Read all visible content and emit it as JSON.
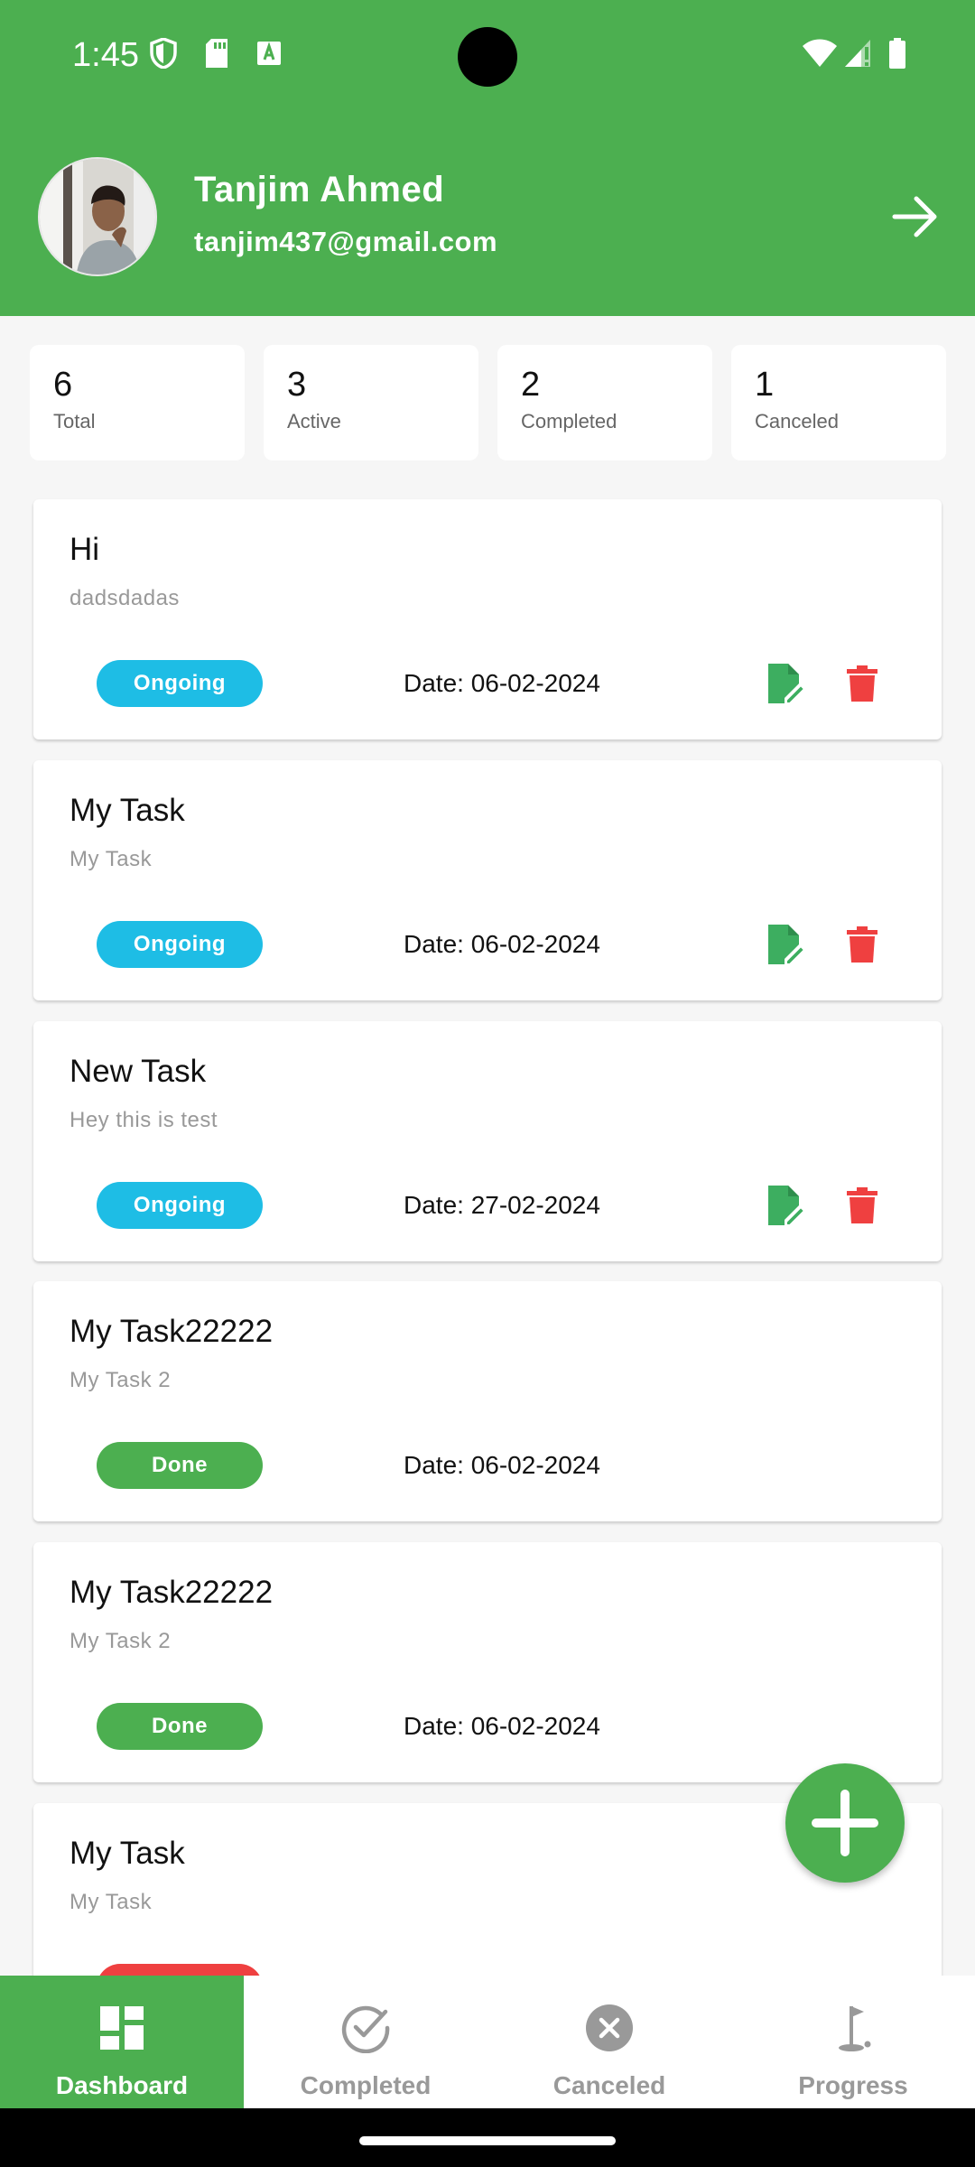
{
  "status_bar": {
    "time": "1:45"
  },
  "user": {
    "name": "Tanjim Ahmed",
    "email": "tanjim437@gmail.com"
  },
  "stats": [
    {
      "count": "6",
      "label": "Total"
    },
    {
      "count": "3",
      "label": "Active"
    },
    {
      "count": "2",
      "label": "Completed"
    },
    {
      "count": "1",
      "label": "Canceled"
    }
  ],
  "tasks": [
    {
      "title": "Hi",
      "description": "dadsdadas",
      "status": "Ongoing",
      "date": "Date: 06-02-2024"
    },
    {
      "title": "My Task",
      "description": "My Task",
      "status": "Ongoing",
      "date": "Date: 06-02-2024"
    },
    {
      "title": "New Task",
      "description": "Hey this is test",
      "status": "Ongoing",
      "date": "Date: 27-02-2024"
    },
    {
      "title": "My Task22222",
      "description": "My Task 2",
      "status": "Done",
      "date": "Date: 06-02-2024"
    },
    {
      "title": "My Task22222",
      "description": "My Task 2",
      "status": "Done",
      "date": "Date: 06-02-2024"
    },
    {
      "title": "My Task",
      "description": "My Task",
      "status": "",
      "date": ""
    }
  ],
  "nav": [
    {
      "label": "Dashboard",
      "icon": "dashboard-icon",
      "active": true
    },
    {
      "label": "Completed",
      "icon": "check-circle-icon",
      "active": false
    },
    {
      "label": "Canceled",
      "icon": "cancel-circle-icon",
      "active": false
    },
    {
      "label": "Progress",
      "icon": "golf-flag-icon",
      "active": false
    }
  ],
  "colors": {
    "primary": "#4CAF50",
    "ongoing": "#1EBDE5",
    "done": "#4CAF50",
    "canceled": "#EF4040",
    "edit": "#3DAE60",
    "delete": "#EF4040"
  }
}
